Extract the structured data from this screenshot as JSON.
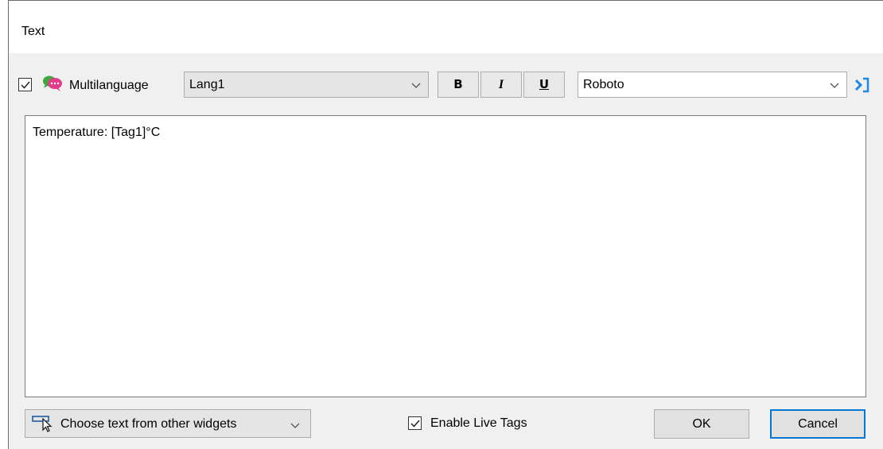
{
  "dialog": {
    "title": "Text"
  },
  "toolbar": {
    "multilanguage_checked": true,
    "multilanguage_label": "Multilanguage",
    "multilanguage_icon": "speech-bubbles-icon",
    "language_value": "Lang1",
    "bold_label": "B",
    "italic_label": "I",
    "underline_label": "U",
    "font_value": "Roboto",
    "expand_icon": "expand-arrow-icon"
  },
  "editor": {
    "text": "Temperature: [Tag1]°C"
  },
  "footer": {
    "choose_label": "Choose text from other widgets",
    "choose_icon": "pointer-select-icon",
    "live_tags_checked": true,
    "live_tags_label": "Enable Live Tags",
    "ok_label": "OK",
    "cancel_label": "Cancel"
  },
  "colors": {
    "accent": "#0078d7",
    "bubble_pink": "#e03c8a",
    "bubble_green": "#3aa83a",
    "expand_blue": "#1e88e5"
  }
}
